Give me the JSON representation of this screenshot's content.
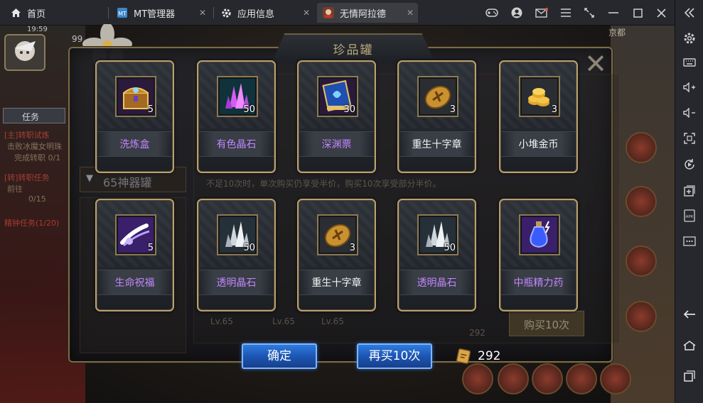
{
  "tabs": [
    {
      "label": "首页",
      "icon": "home-icon"
    },
    {
      "label": "MT管理器",
      "icon": "mt-manager-icon"
    },
    {
      "label": "应用信息",
      "icon": "gear-icon"
    },
    {
      "label": "无情阿拉德",
      "icon": "game-app-icon"
    }
  ],
  "dialog": {
    "title": "珍品罐",
    "confirm_label": "确定",
    "buy_again_label": "再买10次",
    "ticket_count": "292"
  },
  "items": [
    {
      "name": "洗炼盒",
      "count": "5",
      "color": "purple",
      "icon": "treasure-chest-icon"
    },
    {
      "name": "有色晶石",
      "count": "50",
      "color": "purple",
      "icon": "purple-crystal-icon"
    },
    {
      "name": "深渊票",
      "count": "30",
      "color": "purple",
      "icon": "abyss-ticket-icon"
    },
    {
      "name": "重生十字章",
      "count": "3",
      "color": "white",
      "icon": "rebirth-medal-icon"
    },
    {
      "name": "小堆金币",
      "count": "3",
      "color": "white",
      "icon": "gold-coins-icon"
    },
    {
      "name": "生命祝福",
      "count": "5",
      "color": "purple",
      "icon": "life-blessing-icon"
    },
    {
      "name": "透明晶石",
      "count": "50",
      "color": "purple",
      "icon": "clear-crystal-icon"
    },
    {
      "name": "重生十字章",
      "count": "3",
      "color": "white",
      "icon": "rebirth-medal-icon"
    },
    {
      "name": "透明晶石",
      "count": "50",
      "color": "purple",
      "icon": "clear-crystal-icon"
    },
    {
      "name": "中瓶精力药",
      "count": "",
      "color": "purple",
      "icon": "stamina-potion-icon"
    }
  ],
  "background": {
    "task_label": "任务",
    "jar_label": "65神器罐",
    "notice": "不足10次时，单次购买仍享受半价，购买10次享受部分半价。",
    "buy_ten_label": "购买10次",
    "ticket_count_bg": "292",
    "region_label": "京都",
    "levels": [
      "Lv.65",
      "Lv.65",
      "Lv.65"
    ],
    "quest_lines": [
      "[主]转职试炼",
      "击败冰魔女明珠",
      "完成转职 0/1",
      "[转]转职任务",
      "前往",
      "0/15",
      "精钟任务(1/20)"
    ],
    "time": "19:59",
    "player_level": "99"
  },
  "colors": {
    "purple_name": "#c087ff",
    "white_name": "#f2f2f2",
    "button_blue": "#1d56b3",
    "card_border": "#b9a071"
  }
}
